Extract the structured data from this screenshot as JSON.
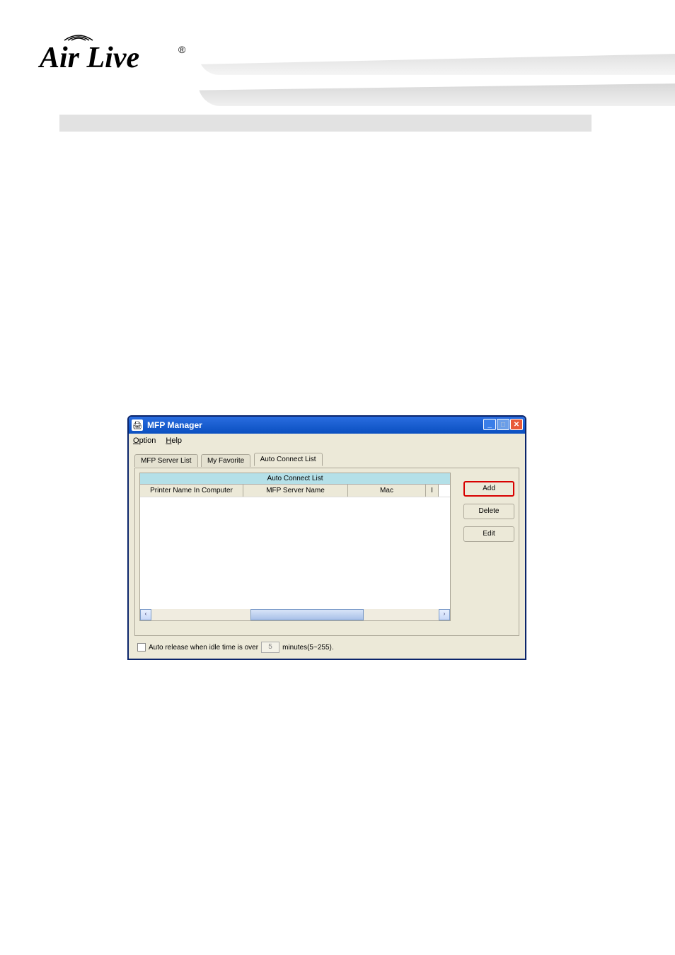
{
  "logo": {
    "text": "Air Live",
    "reg": "®"
  },
  "window": {
    "title": "MFP Manager",
    "menu": {
      "option": "Option",
      "help": "Help"
    },
    "tabs": {
      "server_list": "MFP Server List",
      "my_favorite": "My Favorite",
      "auto_connect": "Auto Connect List"
    },
    "table": {
      "header": "Auto Connect List",
      "cols": {
        "printer": "Printer Name In Computer",
        "server": "MFP Server Name",
        "mac": "Mac",
        "extra": "I"
      }
    },
    "buttons": {
      "add": "Add",
      "delete": "Delete",
      "edit": "Edit"
    },
    "auto_release": {
      "label_before": "Auto release when idle time is over",
      "value": "5",
      "label_after": "minutes(5~255)."
    }
  }
}
